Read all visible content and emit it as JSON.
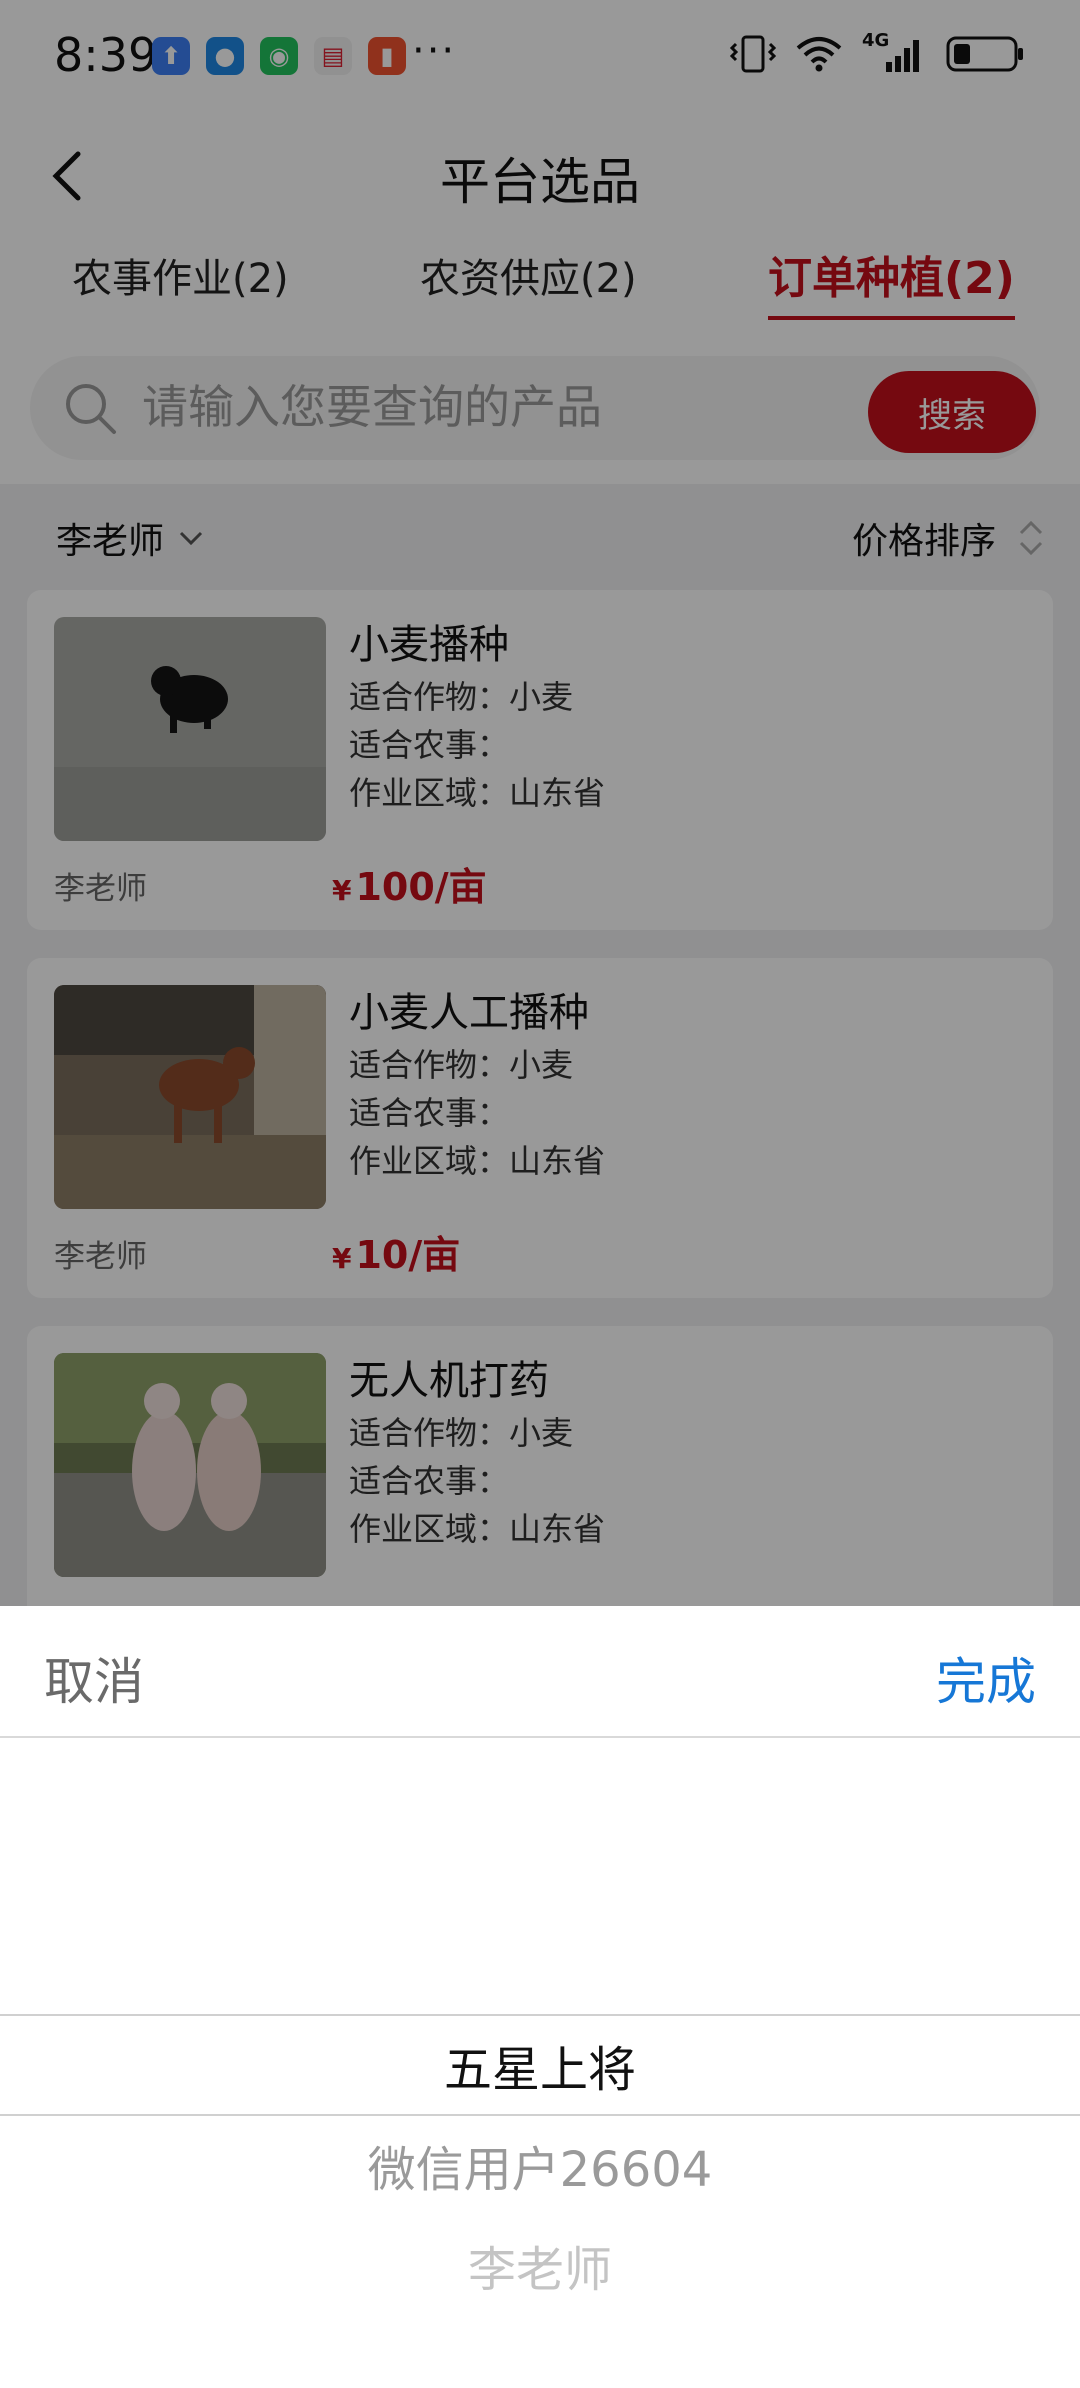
{
  "status_bar": {
    "time": "8:39",
    "apps": [
      {
        "icon": "upload-app-icon",
        "color": "#3d7ff5",
        "glyph": "⬆"
      },
      {
        "icon": "message-app-icon",
        "color": "#1e88e5",
        "glyph": "●"
      },
      {
        "icon": "wechat-icon",
        "color": "#22c35e",
        "glyph": "◉"
      },
      {
        "icon": "calendar-app-icon",
        "color": "#f2f2f2",
        "glyph": "▤"
      },
      {
        "icon": "battery-alert-app-icon",
        "color": "#f0522f",
        "glyph": "▮"
      }
    ],
    "more": "···",
    "network": "4G"
  },
  "header": {
    "title": "平台选品"
  },
  "tabs": [
    {
      "label": "农事作业(2)",
      "active": false
    },
    {
      "label": "农资供应(2)",
      "active": false
    },
    {
      "label": "订单种植(2)",
      "active": true
    }
  ],
  "search": {
    "placeholder": "请输入您要查询的产品",
    "button_label": "搜索"
  },
  "filters": {
    "seller_label": "李老师",
    "sort_label": "价格排序"
  },
  "products": [
    {
      "title": "小麦播种",
      "crop": "适合作物：小麦",
      "farming": "适合农事：",
      "region": "作业区域：山东省",
      "seller": "李老师",
      "currency": "¥",
      "price": "100/亩"
    },
    {
      "title": "小麦人工播种",
      "crop": "适合作物：小麦",
      "farming": "适合农事：",
      "region": "作业区域：山东省",
      "seller": "李老师",
      "currency": "¥",
      "price": "10/亩"
    },
    {
      "title": "无人机打药",
      "crop": "适合作物：小麦",
      "farming": "适合农事：",
      "region": "作业区域：山东省",
      "seller": "",
      "currency": "",
      "price": ""
    }
  ],
  "picker": {
    "cancel_label": "取消",
    "done_label": "完成",
    "options": [
      "五星上将",
      "微信用户26604",
      "李老师"
    ],
    "selected": "五星上将"
  },
  "colors": {
    "accent": "#c40f1c",
    "done_blue": "#1677d6"
  }
}
